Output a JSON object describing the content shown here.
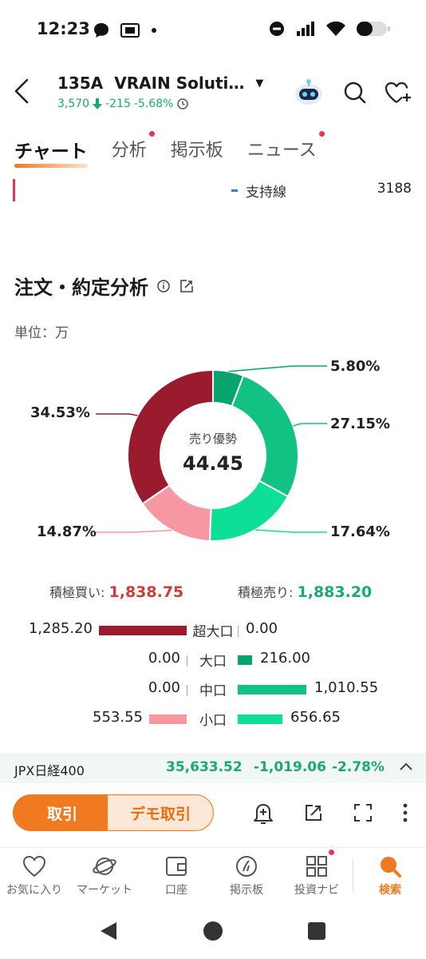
{
  "status": {
    "time": "12:23"
  },
  "header": {
    "code": "135A",
    "name": "VRAIN Soluti…",
    "price": "3,570",
    "change": "-215",
    "change_pct": "-5.68%"
  },
  "tabs": [
    {
      "label": "チャート",
      "active": true,
      "dot": false
    },
    {
      "label": "分析",
      "active": false,
      "dot": true
    },
    {
      "label": "掲示板",
      "active": false,
      "dot": false
    },
    {
      "label": "ニュース",
      "active": false,
      "dot": true
    }
  ],
  "support": {
    "label": "支持線",
    "value": "3188"
  },
  "section": {
    "title": "注文・約定分析",
    "unit": "単位：万"
  },
  "chart_data": {
    "type": "pie",
    "center_label": "売り優勢",
    "center_value": "44.45",
    "slices": [
      {
        "label": "5.80%",
        "value": 5.8,
        "color": "#07a46d"
      },
      {
        "label": "27.15%",
        "value": 27.15,
        "color": "#12c283"
      },
      {
        "label": "17.64%",
        "value": 17.64,
        "color": "#0ddf97"
      },
      {
        "label": "14.87%",
        "value": 14.87,
        "color": "#f797a2"
      },
      {
        "label": "34.53%",
        "value": 34.53,
        "color": "#991b2d"
      }
    ]
  },
  "totals": {
    "buy_label": "積極買い:",
    "buy_value": "1,838.75",
    "sell_label": "積極売り:",
    "sell_value": "1,883.20"
  },
  "orders": [
    {
      "label": "超大口",
      "buy": "1,285.20",
      "buy_num": 1285.2,
      "sell": "0.00",
      "sell_num": 0.0,
      "buy_color": "#991b2d",
      "sell_color": "#07a46d"
    },
    {
      "label": "大口",
      "buy": "0.00",
      "buy_num": 0.0,
      "sell": "216.00",
      "sell_num": 216.0,
      "buy_color": "#991b2d",
      "sell_color": "#07a46d"
    },
    {
      "label": "中口",
      "buy": "0.00",
      "buy_num": 0.0,
      "sell": "1,010.55",
      "sell_num": 1010.55,
      "buy_color": "#f797a2",
      "sell_color": "#12c283"
    },
    {
      "label": "小口",
      "buy": "553.55",
      "buy_num": 553.55,
      "sell": "656.65",
      "sell_num": 656.65,
      "buy_color": "#f797a2",
      "sell_color": "#0ddf97"
    }
  ],
  "index": {
    "name": "JPX日経400",
    "value": "35,633.52",
    "change": "-1,019.06",
    "change_pct": "-2.78%"
  },
  "actions": {
    "trade": "取引",
    "demo": "デモ取引"
  },
  "nav": [
    {
      "label": "お気に入り",
      "icon": "heart-icon",
      "active": false
    },
    {
      "label": "マーケット",
      "icon": "planet-icon",
      "active": false
    },
    {
      "label": "口座",
      "icon": "wallet-icon",
      "active": false
    },
    {
      "label": "掲示板",
      "icon": "board-icon",
      "active": false
    },
    {
      "label": "投資ナビ",
      "icon": "grid-icon",
      "active": false,
      "dot": true
    },
    {
      "label": "検索",
      "icon": "search-icon",
      "active": true
    }
  ]
}
